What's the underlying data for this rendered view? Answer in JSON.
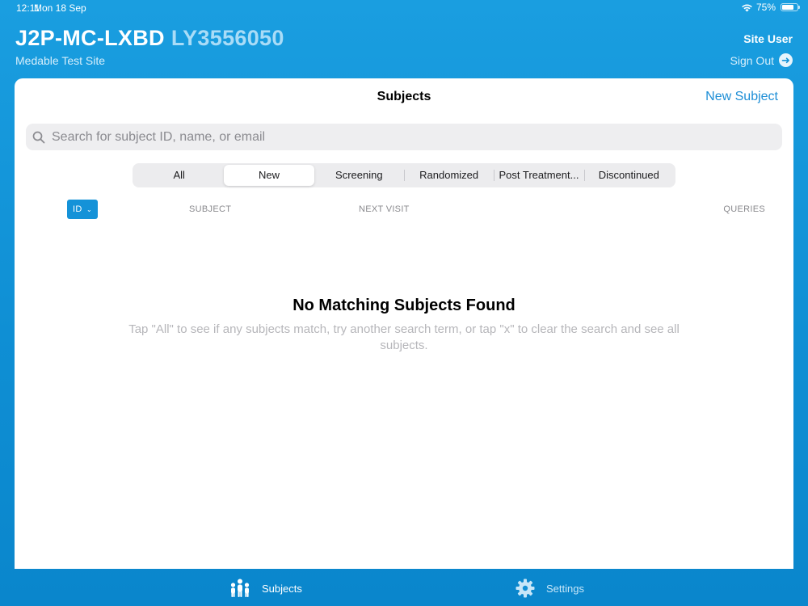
{
  "status_bar": {
    "time": "12:11",
    "date": "Mon 18 Sep",
    "battery": "75%",
    "battery_level": 0.75
  },
  "header": {
    "title_primary": "J2P-MC-LXBD",
    "title_secondary": "LY3556050",
    "site_name": "Medable Test Site",
    "user_role": "Site User",
    "sign_out": "Sign Out"
  },
  "main": {
    "title": "Subjects",
    "new_subject": "New Subject",
    "search_placeholder": "Search for subject ID, name, or email",
    "segments": [
      "All",
      "New",
      "Screening",
      "Randomized",
      "Post Treatment...",
      "Discontinued"
    ],
    "active_segment": "New",
    "columns": {
      "id": "ID",
      "subject": "SUBJECT",
      "next_visit": "NEXT VISIT",
      "queries": "QUERIES"
    },
    "empty_title": "No Matching Subjects Found",
    "empty_message": "Tap \"All\" to see if any subjects match, try another search term, or tap \"x\" to clear the search and see all subjects."
  },
  "tabbar": {
    "subjects": "Subjects",
    "settings": "Settings"
  },
  "colors": {
    "accent": "#1492d8",
    "background": "#1592d6",
    "card": "#ffffff"
  }
}
